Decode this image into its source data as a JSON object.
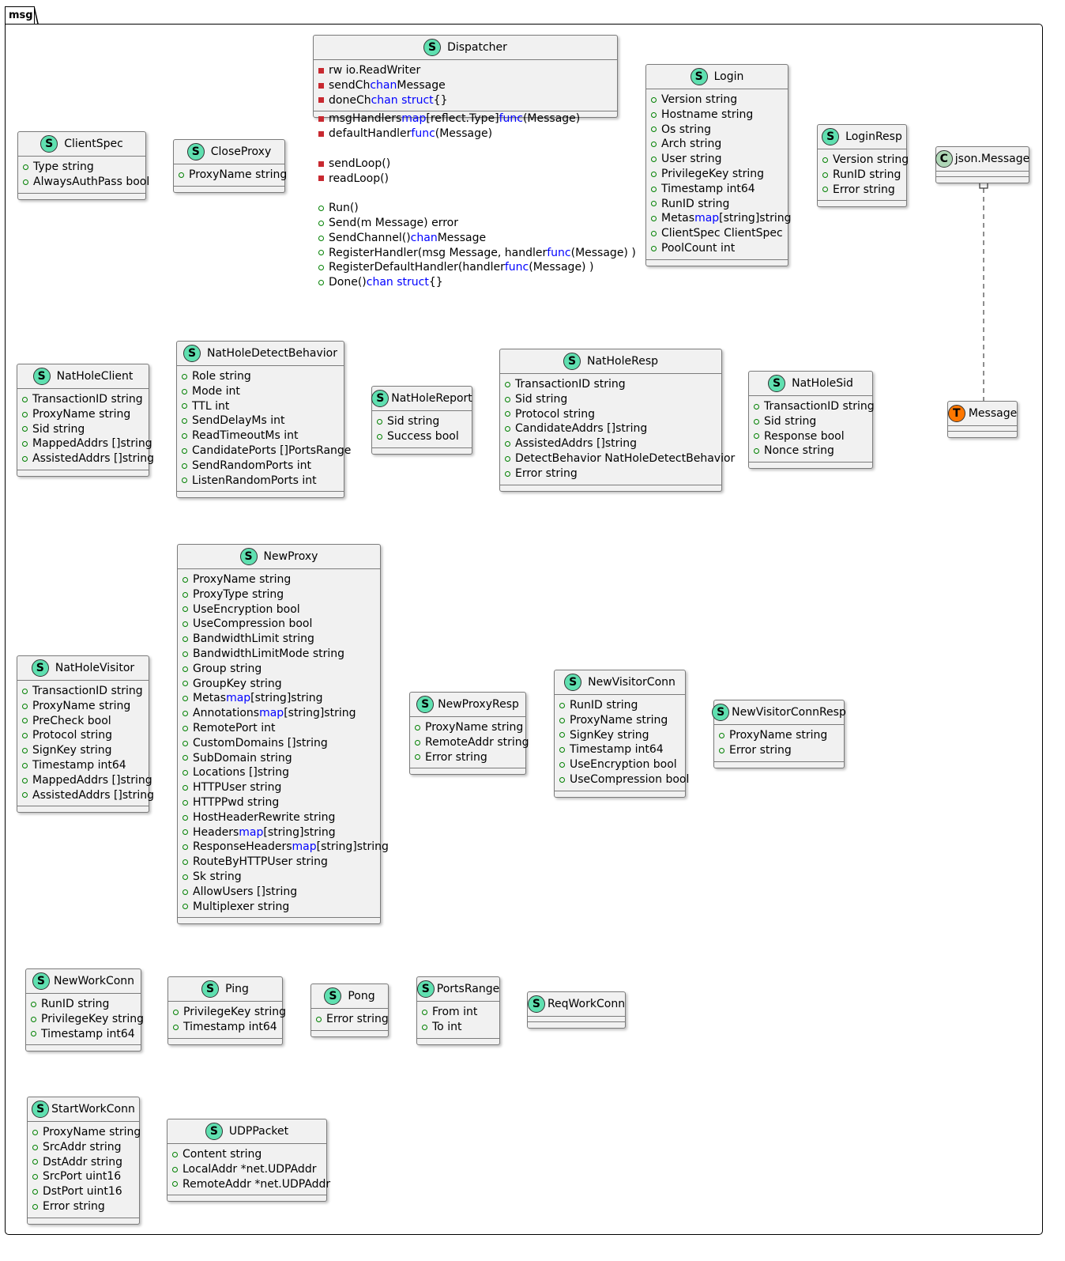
{
  "package": {
    "name": "msg"
  },
  "classes": {
    "ClientSpec": {
      "stereotype": "S",
      "name": "ClientSpec",
      "fields": [
        {
          "text": "Type string"
        },
        {
          "text": "AlwaysAuthPass bool"
        }
      ]
    },
    "CloseProxy": {
      "stereotype": "S",
      "name": "CloseProxy",
      "fields": [
        {
          "text": "ProxyName string"
        }
      ]
    },
    "Dispatcher": {
      "stereotype": "S",
      "name": "Dispatcher",
      "fields": [
        {
          "a": "rw io.ReadWriter"
        },
        {
          "a": "sendCh ",
          "k": "chan",
          "b": " Message"
        },
        {
          "a": "doneCh ",
          "k": "chan struct",
          "b": "{}"
        }
      ],
      "methods": [
        {
          "a": "msgHandlers ",
          "k": "map",
          "b": "[reflect.Type]",
          "k2": "func",
          "c": "(Message)"
        },
        {
          "a": "defaultHandler ",
          "k": "func",
          "b": "(Message)"
        },
        {
          "a": "sendLoop()"
        },
        {
          "a": "readLoop()"
        },
        {
          "a": "Run()"
        },
        {
          "a": "Send(m Message) error"
        },
        {
          "a": "SendChannel() ",
          "k": "chan",
          "b": " Message"
        },
        {
          "a": "RegisterHandler(msg Message, handler ",
          "k": "func",
          "b": "(Message) )"
        },
        {
          "a": "RegisterDefaultHandler(handler ",
          "k": "func",
          "b": "(Message) )"
        },
        {
          "a": "Done() ",
          "k": "chan struct",
          "b": "{}"
        }
      ]
    },
    "Login": {
      "stereotype": "S",
      "name": "Login",
      "fields": [
        {
          "a": "Version string"
        },
        {
          "a": "Hostname string"
        },
        {
          "a": "Os string"
        },
        {
          "a": "Arch string"
        },
        {
          "a": "User string"
        },
        {
          "a": "PrivilegeKey string"
        },
        {
          "a": "Timestamp int64"
        },
        {
          "a": "RunID string"
        },
        {
          "a": "Metas ",
          "k": "map",
          "b": "[string]string"
        },
        {
          "a": "ClientSpec ClientSpec"
        },
        {
          "a": "PoolCount int"
        }
      ]
    },
    "LoginResp": {
      "stereotype": "S",
      "name": "LoginResp",
      "fields": [
        {
          "text": "Version string"
        },
        {
          "text": "RunID string"
        },
        {
          "text": "Error string"
        }
      ]
    },
    "JsonMessage": {
      "stereotype": "C",
      "name": "json.Message"
    },
    "Message": {
      "stereotype": "T",
      "name": "Message"
    },
    "NatHoleClient": {
      "stereotype": "S",
      "name": "NatHoleClient",
      "fields": [
        {
          "text": "TransactionID string"
        },
        {
          "text": "ProxyName string"
        },
        {
          "text": "Sid string"
        },
        {
          "text": "MappedAddrs []string"
        },
        {
          "text": "AssistedAddrs []string"
        }
      ]
    },
    "NatHoleDetectBehavior": {
      "stereotype": "S",
      "name": "NatHoleDetectBehavior",
      "fields": [
        {
          "text": "Role string"
        },
        {
          "text": "Mode int"
        },
        {
          "text": "TTL int"
        },
        {
          "text": "SendDelayMs int"
        },
        {
          "text": "ReadTimeoutMs int"
        },
        {
          "text": "CandidatePorts []PortsRange"
        },
        {
          "text": "SendRandomPorts int"
        },
        {
          "text": "ListenRandomPorts int"
        }
      ]
    },
    "NatHoleReport": {
      "stereotype": "S",
      "name": "NatHoleReport",
      "fields": [
        {
          "text": "Sid string"
        },
        {
          "text": "Success bool"
        }
      ]
    },
    "NatHoleResp": {
      "stereotype": "S",
      "name": "NatHoleResp",
      "fields": [
        {
          "text": "TransactionID string"
        },
        {
          "text": "Sid string"
        },
        {
          "text": "Protocol string"
        },
        {
          "text": "CandidateAddrs []string"
        },
        {
          "text": "AssistedAddrs []string"
        },
        {
          "text": "DetectBehavior NatHoleDetectBehavior"
        },
        {
          "text": "Error string"
        }
      ]
    },
    "NatHoleSid": {
      "stereotype": "S",
      "name": "NatHoleSid",
      "fields": [
        {
          "text": "TransactionID string"
        },
        {
          "text": "Sid string"
        },
        {
          "text": "Response bool"
        },
        {
          "text": "Nonce string"
        }
      ]
    },
    "NatHoleVisitor": {
      "stereotype": "S",
      "name": "NatHoleVisitor",
      "fields": [
        {
          "text": "TransactionID string"
        },
        {
          "text": "ProxyName string"
        },
        {
          "text": "PreCheck bool"
        },
        {
          "text": "Protocol string"
        },
        {
          "text": "SignKey string"
        },
        {
          "text": "Timestamp int64"
        },
        {
          "text": "MappedAddrs []string"
        },
        {
          "text": "AssistedAddrs []string"
        }
      ]
    },
    "NewProxy": {
      "stereotype": "S",
      "name": "NewProxy",
      "fields": [
        {
          "a": "ProxyName string"
        },
        {
          "a": "ProxyType string"
        },
        {
          "a": "UseEncryption bool"
        },
        {
          "a": "UseCompression bool"
        },
        {
          "a": "BandwidthLimit string"
        },
        {
          "a": "BandwidthLimitMode string"
        },
        {
          "a": "Group string"
        },
        {
          "a": "GroupKey string"
        },
        {
          "a": "Metas ",
          "k": "map",
          "b": "[string]string"
        },
        {
          "a": "Annotations ",
          "k": "map",
          "b": "[string]string"
        },
        {
          "a": "RemotePort int"
        },
        {
          "a": "CustomDomains []string"
        },
        {
          "a": "SubDomain string"
        },
        {
          "a": "Locations []string"
        },
        {
          "a": "HTTPUser string"
        },
        {
          "a": "HTTPPwd string"
        },
        {
          "a": "HostHeaderRewrite string"
        },
        {
          "a": "Headers ",
          "k": "map",
          "b": "[string]string"
        },
        {
          "a": "ResponseHeaders ",
          "k": "map",
          "b": "[string]string"
        },
        {
          "a": "RouteByHTTPUser string"
        },
        {
          "a": "Sk string"
        },
        {
          "a": "AllowUsers []string"
        },
        {
          "a": "Multiplexer string"
        }
      ]
    },
    "NewProxyResp": {
      "stereotype": "S",
      "name": "NewProxyResp",
      "fields": [
        {
          "text": "ProxyName string"
        },
        {
          "text": "RemoteAddr string"
        },
        {
          "text": "Error string"
        }
      ]
    },
    "NewVisitorConn": {
      "stereotype": "S",
      "name": "NewVisitorConn",
      "fields": [
        {
          "text": "RunID string"
        },
        {
          "text": "ProxyName string"
        },
        {
          "text": "SignKey string"
        },
        {
          "text": "Timestamp int64"
        },
        {
          "text": "UseEncryption bool"
        },
        {
          "text": "UseCompression bool"
        }
      ]
    },
    "NewVisitorConnResp": {
      "stereotype": "S",
      "name": "NewVisitorConnResp",
      "fields": [
        {
          "text": "ProxyName string"
        },
        {
          "text": "Error string"
        }
      ]
    },
    "NewWorkConn": {
      "stereotype": "S",
      "name": "NewWorkConn",
      "fields": [
        {
          "text": "RunID string"
        },
        {
          "text": "PrivilegeKey string"
        },
        {
          "text": "Timestamp int64"
        }
      ]
    },
    "Ping": {
      "stereotype": "S",
      "name": "Ping",
      "fields": [
        {
          "text": "PrivilegeKey string"
        },
        {
          "text": "Timestamp int64"
        }
      ]
    },
    "Pong": {
      "stereotype": "S",
      "name": "Pong",
      "fields": [
        {
          "text": "Error string"
        }
      ]
    },
    "PortsRange": {
      "stereotype": "S",
      "name": "PortsRange",
      "fields": [
        {
          "text": "From int"
        },
        {
          "text": "To int"
        }
      ]
    },
    "ReqWorkConn": {
      "stereotype": "S",
      "name": "ReqWorkConn"
    },
    "StartWorkConn": {
      "stereotype": "S",
      "name": "StartWorkConn",
      "fields": [
        {
          "text": "ProxyName string"
        },
        {
          "text": "SrcAddr string"
        },
        {
          "text": "DstAddr string"
        },
        {
          "text": "SrcPort uint16"
        },
        {
          "text": "DstPort uint16"
        },
        {
          "text": "Error string"
        }
      ]
    },
    "UDPPacket": {
      "stereotype": "S",
      "name": "UDPPacket",
      "fields": [
        {
          "text": "Content string"
        },
        {
          "text": "LocalAddr *net.UDPAddr"
        },
        {
          "text": "RemoteAddr *net.UDPAddr"
        }
      ]
    }
  },
  "relations": [
    {
      "from": "json.Message",
      "to": "Message",
      "style": "dashed"
    }
  ],
  "colors": {
    "struct_badge": "#5fe0b0",
    "class_badge": "#aed6b6",
    "type_badge": "#ff7700",
    "keyword": "#0000ff",
    "private": "#c82930",
    "public": "#008000",
    "box_fill": "#f1f1f1"
  }
}
